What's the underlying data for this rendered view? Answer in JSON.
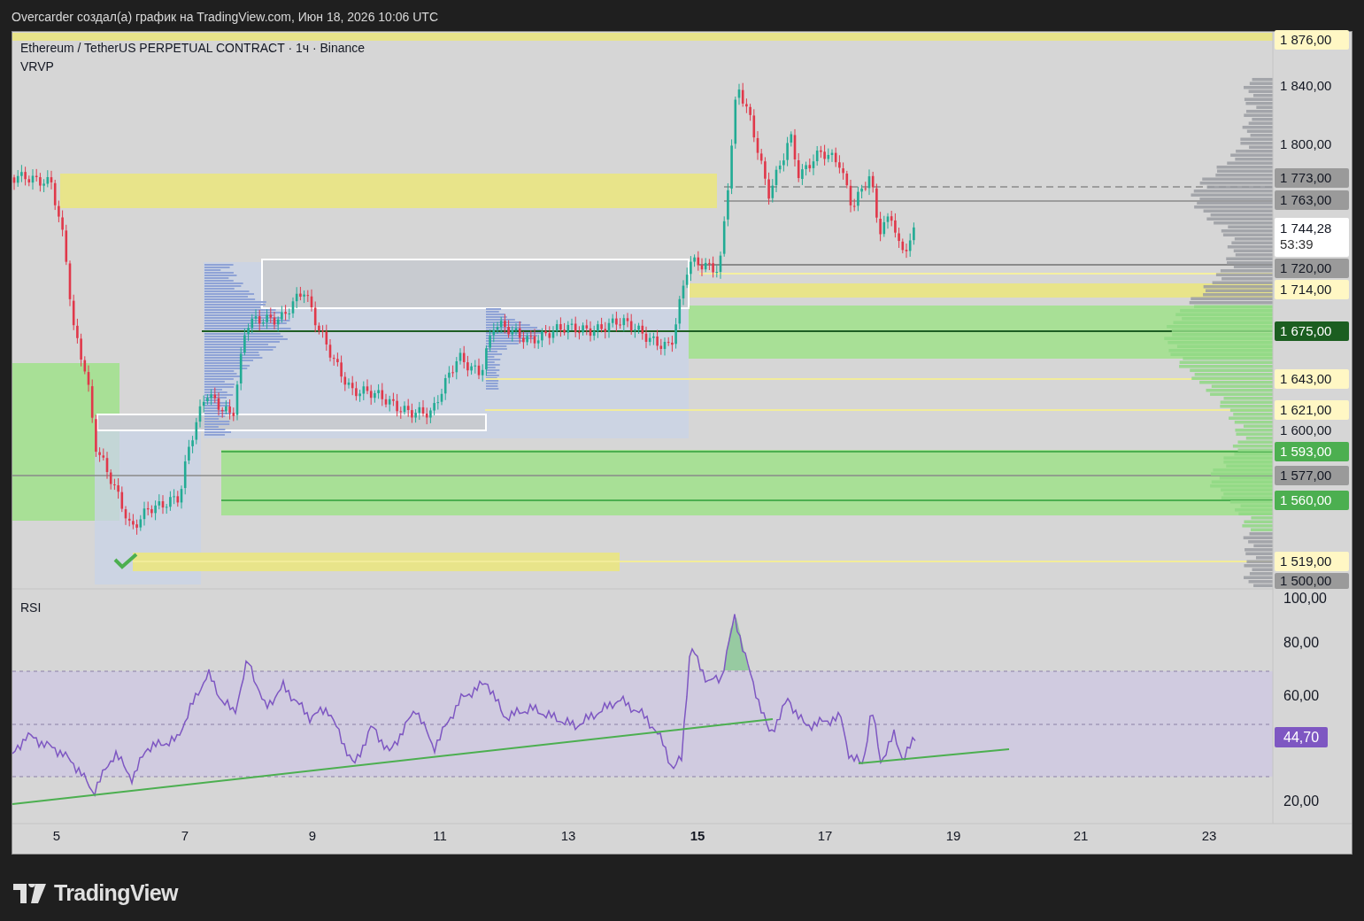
{
  "header": {
    "caption": "Overcarder создал(а) график на TradingView.com, Июн 18, 2026 10:06 UTC"
  },
  "chart": {
    "symbol": "Ethereum / TetherUS PERPETUAL CONTRACT · 1ч · Binance",
    "indicator": "VRVP"
  },
  "price_scale": {
    "ticks": [
      "1 840,00",
      "1 800,00",
      "1 600,00"
    ],
    "badges": [
      {
        "text": "1 876,00",
        "kind": "level"
      },
      {
        "text": "1 773,00",
        "kind": "line"
      },
      {
        "text": "1 763,00",
        "kind": "line"
      },
      {
        "text": "1 744,28",
        "sub": "53:39",
        "kind": "last"
      },
      {
        "text": "1 720,00",
        "kind": "line"
      },
      {
        "text": "1 714,00",
        "kind": "level"
      },
      {
        "text": "1 675,00",
        "kind": "poc"
      },
      {
        "text": "1 643,00",
        "kind": "level"
      },
      {
        "text": "1 621,00",
        "kind": "level"
      },
      {
        "text": "1 593,00",
        "kind": "zone"
      },
      {
        "text": "1 577,00",
        "kind": "line"
      },
      {
        "text": "1 560,00",
        "kind": "zone"
      },
      {
        "text": "1 519,00",
        "kind": "level"
      },
      {
        "text": "1 500,00",
        "kind": "line"
      }
    ]
  },
  "rsi": {
    "title": "RSI",
    "ticks": [
      "100,00",
      "80,00",
      "60,00",
      "20,00"
    ],
    "value": "44,70"
  },
  "time_axis": {
    "labels": [
      {
        "text": "5",
        "bold": false
      },
      {
        "text": "7",
        "bold": false
      },
      {
        "text": "9",
        "bold": false
      },
      {
        "text": "11",
        "bold": false
      },
      {
        "text": "13",
        "bold": false
      },
      {
        "text": "15",
        "bold": true
      },
      {
        "text": "17",
        "bold": false
      },
      {
        "text": "19",
        "bold": false
      },
      {
        "text": "21",
        "bold": false
      },
      {
        "text": "23",
        "bold": false
      }
    ]
  },
  "footer": {
    "logo": "TradingView"
  }
}
